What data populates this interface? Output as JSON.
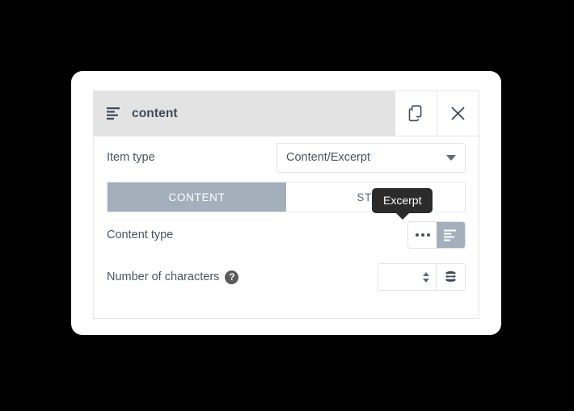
{
  "panel": {
    "title": "content",
    "title_icon": "align-left-list-icon",
    "header_actions": [
      {
        "name": "duplicate-button",
        "icon": "copy-icon"
      },
      {
        "name": "close-button",
        "icon": "close-icon"
      }
    ]
  },
  "fields": {
    "item_type": {
      "label": "Item type",
      "value": "Content/Excerpt",
      "caret_icon": "chevron-down-icon"
    },
    "content_type": {
      "label": "Content type",
      "options": [
        {
          "name": "content-type-ellipsis",
          "icon": "ellipsis-icon",
          "active": false
        },
        {
          "name": "content-type-excerpt",
          "icon": "align-left-icon",
          "active": true
        }
      ]
    },
    "number_of_characters": {
      "label": "Number of characters",
      "help_icon": "help-question-icon",
      "value": "",
      "placeholder": "",
      "spinner_icon": "spinner-up-down-icon",
      "dynamic_icon": "database-icon"
    }
  },
  "tabs": [
    {
      "label": "CONTENT",
      "active": true
    },
    {
      "label": "STYLE",
      "active": false
    }
  ],
  "tooltip": {
    "text": "Excerpt"
  },
  "colors": {
    "accent": "#a3b0bc",
    "header_bg": "#e3e3e3",
    "text": "#4a545f",
    "tooltip_bg": "#2b2b2b",
    "page_bg": "#000000"
  }
}
